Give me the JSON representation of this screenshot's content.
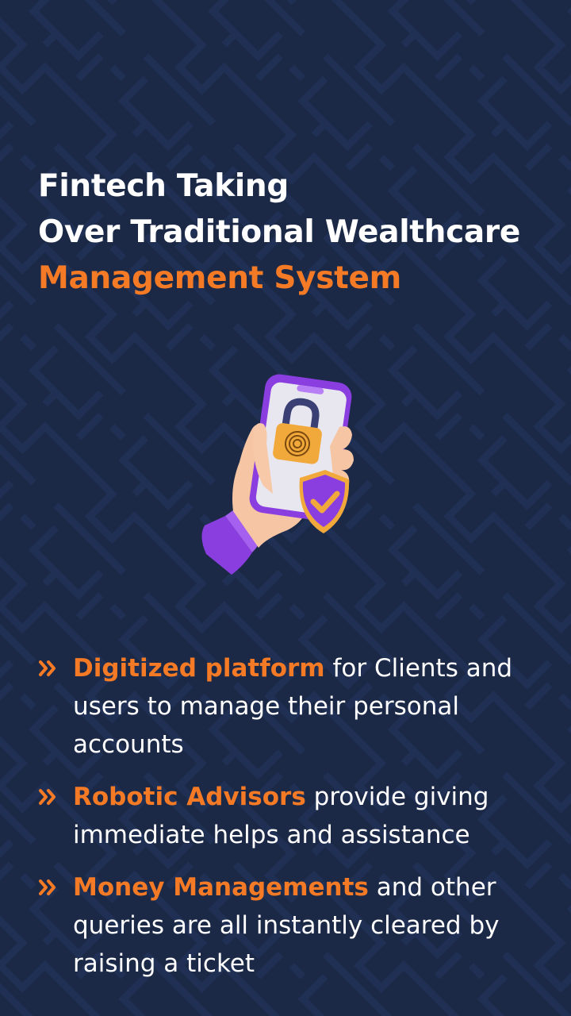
{
  "headline": {
    "line1": "Fintech Taking",
    "line2": "Over Traditional Wealthcare",
    "line3": "Management System"
  },
  "illustration": {
    "icons": [
      "hand-holding-phone",
      "padlock-icon",
      "fingerprint-icon",
      "shield-check-icon"
    ]
  },
  "points": [
    {
      "highlight": "Digitized platform",
      "text": " for Clients and users to manage their personal accounts"
    },
    {
      "highlight": "Robotic Advisors",
      "text": " provide giving immediate helps and assistance"
    },
    {
      "highlight": "Money Managements",
      "text": " and other queries are all instantly cleared by raising a ticket"
    }
  ],
  "colors": {
    "background": "#1b2946",
    "accent": "#f47a25",
    "text": "#ffffff",
    "purple": "#8a3ee0",
    "lock_gold": "#f2a93b"
  }
}
